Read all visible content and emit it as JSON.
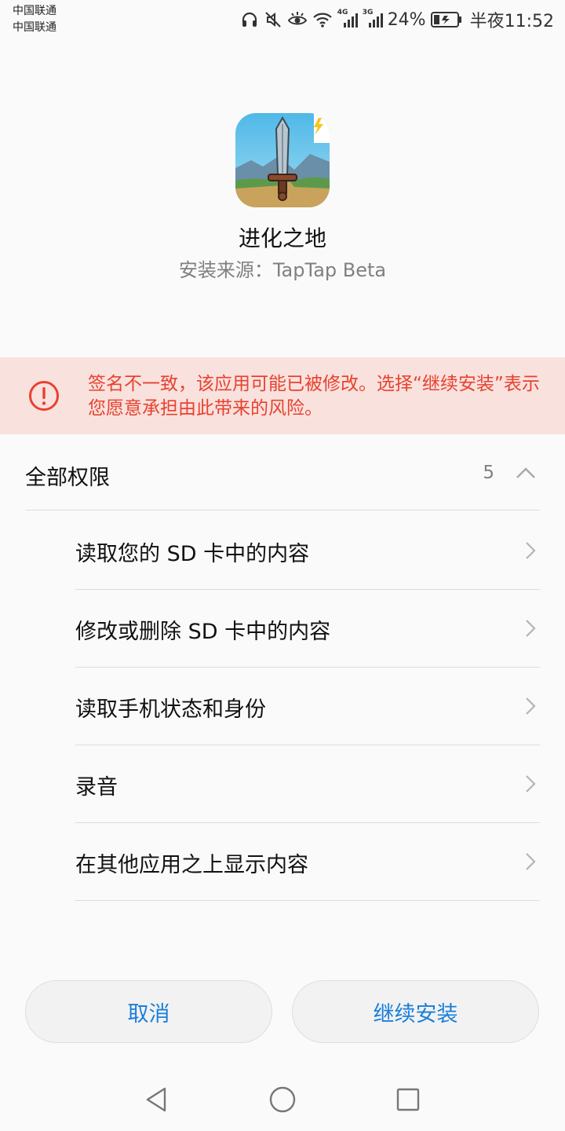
{
  "status_bar": {
    "carrier_1": "中国联通",
    "carrier_2": "中国联通",
    "network_1": "4G",
    "network_2": "3G",
    "battery": "24%",
    "time": "半夜11:52"
  },
  "app": {
    "name": "进化之地",
    "install_source": "安装来源：TapTap Beta",
    "icon": "game-sword-icon"
  },
  "warning": {
    "text": "签名不一致，该应用可能已被修改。选择“继续安装”表示您愿意承担由此带来的风险。",
    "color": "#e8422e",
    "background": "#f9e1de"
  },
  "permissions": {
    "title": "全部权限",
    "count": "5",
    "items": [
      {
        "label": "读取您的 SD 卡中的内容"
      },
      {
        "label": "修改或删除 SD 卡中的内容"
      },
      {
        "label": "读取手机状态和身份"
      },
      {
        "label": "录音"
      },
      {
        "label": "在其他应用之上显示内容"
      }
    ]
  },
  "buttons": {
    "cancel": "取消",
    "continue": "继续安装",
    "accent": "#1a7fd9"
  }
}
